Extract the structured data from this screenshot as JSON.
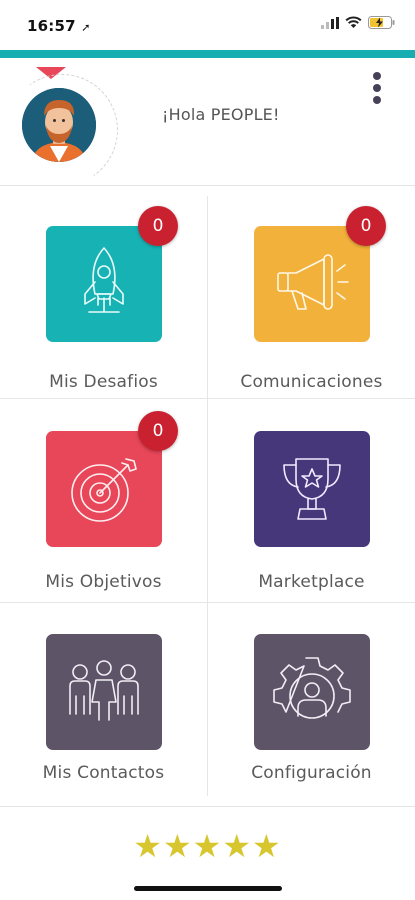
{
  "status_bar": {
    "time": "16:57",
    "location_arrow": "➚",
    "icons": [
      "cellular-signal-icon",
      "wifi-icon",
      "battery-charging-icon"
    ]
  },
  "header": {
    "greeting": "¡Hola PEOPLE!",
    "avatar": "avatar-illustration",
    "menu": "more-vert-icon"
  },
  "tiles": [
    {
      "label": "Mis Desafios",
      "badge": "0",
      "color": "#17b3b4",
      "icon": "rocket-icon"
    },
    {
      "label": "Comunicaciones",
      "badge": "0",
      "color": "#f2b13b",
      "icon": "megaphone-icon"
    },
    {
      "label": "Mis Objetivos",
      "badge": "0",
      "color": "#e84659",
      "icon": "target-icon"
    },
    {
      "label": "Marketplace",
      "badge": "",
      "color": "#46367a",
      "icon": "trophy-icon"
    },
    {
      "label": "Mis Contactos",
      "badge": "",
      "color": "#5d5468",
      "icon": "people-icon"
    },
    {
      "label": "Configuración",
      "badge": "",
      "color": "#5d5468",
      "icon": "gear-icon"
    }
  ],
  "footer": {
    "rating": "★★★★★",
    "rating_value": 5,
    "star_color": "#d8c62f"
  },
  "colors": {
    "accent": "#17aeb2",
    "badge": "#c9212f"
  }
}
